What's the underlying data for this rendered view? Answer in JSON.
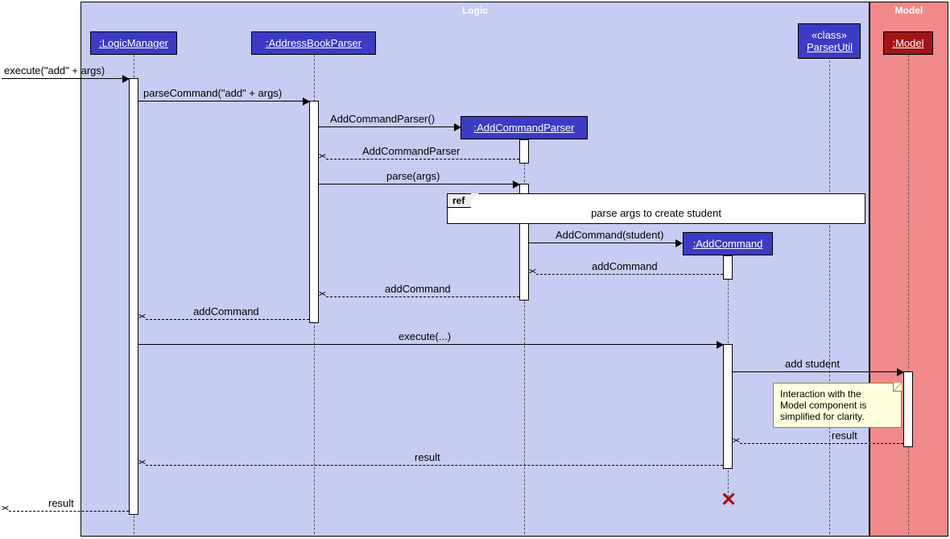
{
  "frames": {
    "logic": "Logic",
    "model": "Model"
  },
  "participants": {
    "logicManager": ":LogicManager",
    "addressBookParser": ":AddressBookParser",
    "addCommandParser": ":AddCommandParser",
    "addCommand": ":AddCommand",
    "parserUtil": "«class»\nParserUtil",
    "model": ":Model"
  },
  "messages": {
    "m1": "execute(\"add\" + args)",
    "m2": "parseCommand(\"add\" + args)",
    "m3": "AddCommandParser()",
    "m4": "AddCommandParser",
    "m5": "parse(args)",
    "m6": "AddCommand(student)",
    "m7": "addCommand",
    "m8": "addCommand",
    "m9": "addCommand",
    "m10": "execute(...)",
    "m11": "add student",
    "m12": "result",
    "m13": "result",
    "m14": "result"
  },
  "ref": {
    "label": "ref",
    "text": "parse args to create student"
  },
  "note": {
    "line1": "Interaction with the",
    "line2": "Model component is",
    "line3": "simplified for clarity."
  }
}
